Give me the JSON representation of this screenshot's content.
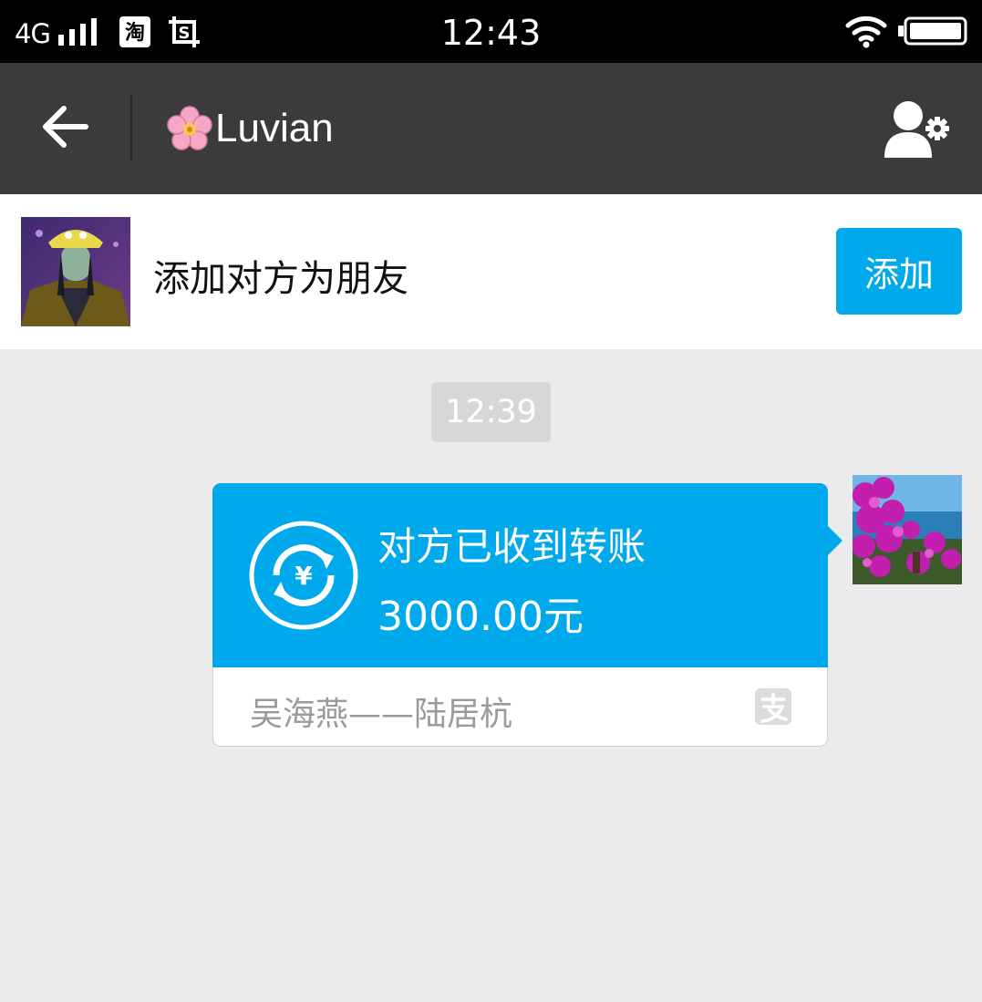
{
  "status_bar": {
    "network": "4G",
    "time": "12:43",
    "app_icons": [
      "taobao-icon",
      "screenshot-icon"
    ]
  },
  "header": {
    "title": "Luvian",
    "title_emoji": "cherry-blossom-icon",
    "back_icon": "arrow-left-icon",
    "profile_icon": "person-settings-icon"
  },
  "add_friend": {
    "prompt": "添加对方为朋友",
    "button_label": "添加"
  },
  "chat": {
    "timestamp": "12:39",
    "transfer": {
      "status": "对方已收到转账",
      "amount": "3000.00元",
      "memo": "吴海燕——陆居杭",
      "icon": "yuan-transfer-icon",
      "brand_icon": "alipay-icon"
    }
  },
  "colors": {
    "status_bar": "#000000",
    "header": "#3b3b3b",
    "accent": "#00a8ec",
    "chat_background": "#ebebeb",
    "timestamp_pill": "#d7d7d7"
  }
}
